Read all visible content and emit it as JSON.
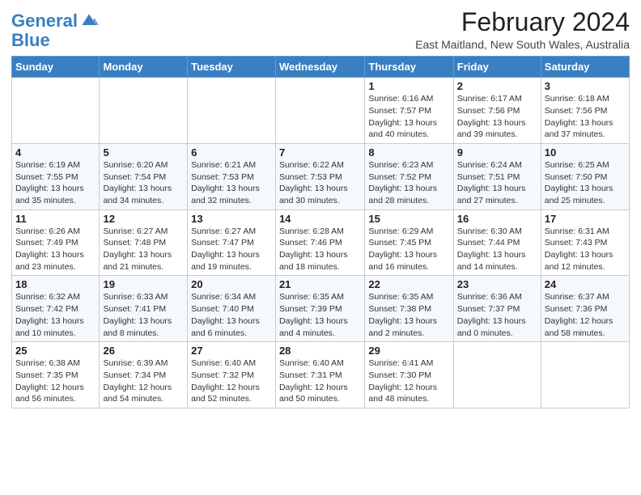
{
  "logo": {
    "line1": "General",
    "line2": "Blue"
  },
  "title": "February 2024",
  "subtitle": "East Maitland, New South Wales, Australia",
  "headers": [
    "Sunday",
    "Monday",
    "Tuesday",
    "Wednesday",
    "Thursday",
    "Friday",
    "Saturday"
  ],
  "weeks": [
    [
      {
        "day": "",
        "info": ""
      },
      {
        "day": "",
        "info": ""
      },
      {
        "day": "",
        "info": ""
      },
      {
        "day": "",
        "info": ""
      },
      {
        "day": "1",
        "info": "Sunrise: 6:16 AM\nSunset: 7:57 PM\nDaylight: 13 hours and 40 minutes."
      },
      {
        "day": "2",
        "info": "Sunrise: 6:17 AM\nSunset: 7:56 PM\nDaylight: 13 hours and 39 minutes."
      },
      {
        "day": "3",
        "info": "Sunrise: 6:18 AM\nSunset: 7:56 PM\nDaylight: 13 hours and 37 minutes."
      }
    ],
    [
      {
        "day": "4",
        "info": "Sunrise: 6:19 AM\nSunset: 7:55 PM\nDaylight: 13 hours and 35 minutes."
      },
      {
        "day": "5",
        "info": "Sunrise: 6:20 AM\nSunset: 7:54 PM\nDaylight: 13 hours and 34 minutes."
      },
      {
        "day": "6",
        "info": "Sunrise: 6:21 AM\nSunset: 7:53 PM\nDaylight: 13 hours and 32 minutes."
      },
      {
        "day": "7",
        "info": "Sunrise: 6:22 AM\nSunset: 7:53 PM\nDaylight: 13 hours and 30 minutes."
      },
      {
        "day": "8",
        "info": "Sunrise: 6:23 AM\nSunset: 7:52 PM\nDaylight: 13 hours and 28 minutes."
      },
      {
        "day": "9",
        "info": "Sunrise: 6:24 AM\nSunset: 7:51 PM\nDaylight: 13 hours and 27 minutes."
      },
      {
        "day": "10",
        "info": "Sunrise: 6:25 AM\nSunset: 7:50 PM\nDaylight: 13 hours and 25 minutes."
      }
    ],
    [
      {
        "day": "11",
        "info": "Sunrise: 6:26 AM\nSunset: 7:49 PM\nDaylight: 13 hours and 23 minutes."
      },
      {
        "day": "12",
        "info": "Sunrise: 6:27 AM\nSunset: 7:48 PM\nDaylight: 13 hours and 21 minutes."
      },
      {
        "day": "13",
        "info": "Sunrise: 6:27 AM\nSunset: 7:47 PM\nDaylight: 13 hours and 19 minutes."
      },
      {
        "day": "14",
        "info": "Sunrise: 6:28 AM\nSunset: 7:46 PM\nDaylight: 13 hours and 18 minutes."
      },
      {
        "day": "15",
        "info": "Sunrise: 6:29 AM\nSunset: 7:45 PM\nDaylight: 13 hours and 16 minutes."
      },
      {
        "day": "16",
        "info": "Sunrise: 6:30 AM\nSunset: 7:44 PM\nDaylight: 13 hours and 14 minutes."
      },
      {
        "day": "17",
        "info": "Sunrise: 6:31 AM\nSunset: 7:43 PM\nDaylight: 13 hours and 12 minutes."
      }
    ],
    [
      {
        "day": "18",
        "info": "Sunrise: 6:32 AM\nSunset: 7:42 PM\nDaylight: 13 hours and 10 minutes."
      },
      {
        "day": "19",
        "info": "Sunrise: 6:33 AM\nSunset: 7:41 PM\nDaylight: 13 hours and 8 minutes."
      },
      {
        "day": "20",
        "info": "Sunrise: 6:34 AM\nSunset: 7:40 PM\nDaylight: 13 hours and 6 minutes."
      },
      {
        "day": "21",
        "info": "Sunrise: 6:35 AM\nSunset: 7:39 PM\nDaylight: 13 hours and 4 minutes."
      },
      {
        "day": "22",
        "info": "Sunrise: 6:35 AM\nSunset: 7:38 PM\nDaylight: 13 hours and 2 minutes."
      },
      {
        "day": "23",
        "info": "Sunrise: 6:36 AM\nSunset: 7:37 PM\nDaylight: 13 hours and 0 minutes."
      },
      {
        "day": "24",
        "info": "Sunrise: 6:37 AM\nSunset: 7:36 PM\nDaylight: 12 hours and 58 minutes."
      }
    ],
    [
      {
        "day": "25",
        "info": "Sunrise: 6:38 AM\nSunset: 7:35 PM\nDaylight: 12 hours and 56 minutes."
      },
      {
        "day": "26",
        "info": "Sunrise: 6:39 AM\nSunset: 7:34 PM\nDaylight: 12 hours and 54 minutes."
      },
      {
        "day": "27",
        "info": "Sunrise: 6:40 AM\nSunset: 7:32 PM\nDaylight: 12 hours and 52 minutes."
      },
      {
        "day": "28",
        "info": "Sunrise: 6:40 AM\nSunset: 7:31 PM\nDaylight: 12 hours and 50 minutes."
      },
      {
        "day": "29",
        "info": "Sunrise: 6:41 AM\nSunset: 7:30 PM\nDaylight: 12 hours and 48 minutes."
      },
      {
        "day": "",
        "info": ""
      },
      {
        "day": "",
        "info": ""
      }
    ]
  ]
}
